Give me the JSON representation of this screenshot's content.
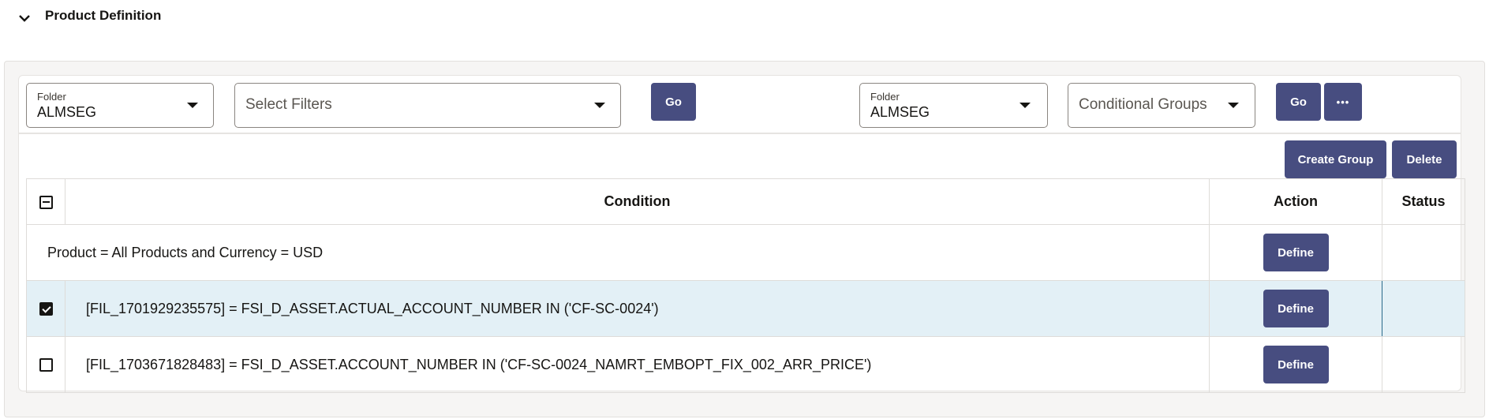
{
  "section": {
    "title": "Product Definition",
    "expanded": true
  },
  "filters": {
    "left": {
      "folder_label": "Folder",
      "folder_value": "ALMSEG",
      "filter_placeholder": "Select Filters",
      "go_label": "Go"
    },
    "right": {
      "folder_label": "Folder",
      "folder_value": "ALMSEG",
      "group_value": "Conditional Groups",
      "go_label": "Go",
      "more_label": "•••"
    }
  },
  "toolbar": {
    "create_group_label": "Create Group",
    "delete_label": "Delete"
  },
  "table": {
    "columns": {
      "select": "",
      "condition": "Condition",
      "action": "Action",
      "status": "Status"
    },
    "header_checkbox_state": "partial",
    "rows": [
      {
        "condition": "Product = All Products and Currency = USD",
        "has_checkbox": false,
        "checked": false,
        "action_label": "Define",
        "status": ""
      },
      {
        "condition": "[FIL_1701929235575] = FSI_D_ASSET.ACTUAL_ACCOUNT_NUMBER IN ('CF-SC-0024')",
        "has_checkbox": true,
        "checked": true,
        "action_label": "Define",
        "status": ""
      },
      {
        "condition": "[FIL_1703671828483] = FSI_D_ASSET.ACCOUNT_NUMBER IN ('CF-SC-0024_NAMRT_EMBOPT_FIX_002_ARR_PRICE')",
        "has_checkbox": true,
        "checked": false,
        "action_label": "Define",
        "status": ""
      }
    ]
  },
  "colors": {
    "primary_button": "#474d80",
    "selected_row": "#e3f0f6",
    "panel_bg": "#f6f5f4"
  }
}
